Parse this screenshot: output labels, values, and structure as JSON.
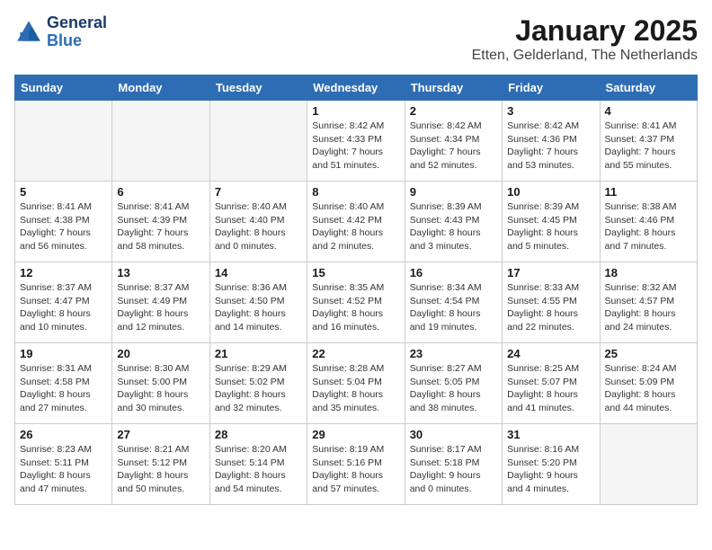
{
  "logo": {
    "line1": "General",
    "line2": "Blue"
  },
  "title": "January 2025",
  "subtitle": "Etten, Gelderland, The Netherlands",
  "headers": [
    "Sunday",
    "Monday",
    "Tuesday",
    "Wednesday",
    "Thursday",
    "Friday",
    "Saturday"
  ],
  "weeks": [
    [
      {
        "date": "",
        "info": ""
      },
      {
        "date": "",
        "info": ""
      },
      {
        "date": "",
        "info": ""
      },
      {
        "date": "1",
        "info": "Sunrise: 8:42 AM\nSunset: 4:33 PM\nDaylight: 7 hours\nand 51 minutes."
      },
      {
        "date": "2",
        "info": "Sunrise: 8:42 AM\nSunset: 4:34 PM\nDaylight: 7 hours\nand 52 minutes."
      },
      {
        "date": "3",
        "info": "Sunrise: 8:42 AM\nSunset: 4:36 PM\nDaylight: 7 hours\nand 53 minutes."
      },
      {
        "date": "4",
        "info": "Sunrise: 8:41 AM\nSunset: 4:37 PM\nDaylight: 7 hours\nand 55 minutes."
      }
    ],
    [
      {
        "date": "5",
        "info": "Sunrise: 8:41 AM\nSunset: 4:38 PM\nDaylight: 7 hours\nand 56 minutes."
      },
      {
        "date": "6",
        "info": "Sunrise: 8:41 AM\nSunset: 4:39 PM\nDaylight: 7 hours\nand 58 minutes."
      },
      {
        "date": "7",
        "info": "Sunrise: 8:40 AM\nSunset: 4:40 PM\nDaylight: 8 hours\nand 0 minutes."
      },
      {
        "date": "8",
        "info": "Sunrise: 8:40 AM\nSunset: 4:42 PM\nDaylight: 8 hours\nand 2 minutes."
      },
      {
        "date": "9",
        "info": "Sunrise: 8:39 AM\nSunset: 4:43 PM\nDaylight: 8 hours\nand 3 minutes."
      },
      {
        "date": "10",
        "info": "Sunrise: 8:39 AM\nSunset: 4:45 PM\nDaylight: 8 hours\nand 5 minutes."
      },
      {
        "date": "11",
        "info": "Sunrise: 8:38 AM\nSunset: 4:46 PM\nDaylight: 8 hours\nand 7 minutes."
      }
    ],
    [
      {
        "date": "12",
        "info": "Sunrise: 8:37 AM\nSunset: 4:47 PM\nDaylight: 8 hours\nand 10 minutes."
      },
      {
        "date": "13",
        "info": "Sunrise: 8:37 AM\nSunset: 4:49 PM\nDaylight: 8 hours\nand 12 minutes."
      },
      {
        "date": "14",
        "info": "Sunrise: 8:36 AM\nSunset: 4:50 PM\nDaylight: 8 hours\nand 14 minutes."
      },
      {
        "date": "15",
        "info": "Sunrise: 8:35 AM\nSunset: 4:52 PM\nDaylight: 8 hours\nand 16 minutes."
      },
      {
        "date": "16",
        "info": "Sunrise: 8:34 AM\nSunset: 4:54 PM\nDaylight: 8 hours\nand 19 minutes."
      },
      {
        "date": "17",
        "info": "Sunrise: 8:33 AM\nSunset: 4:55 PM\nDaylight: 8 hours\nand 22 minutes."
      },
      {
        "date": "18",
        "info": "Sunrise: 8:32 AM\nSunset: 4:57 PM\nDaylight: 8 hours\nand 24 minutes."
      }
    ],
    [
      {
        "date": "19",
        "info": "Sunrise: 8:31 AM\nSunset: 4:58 PM\nDaylight: 8 hours\nand 27 minutes."
      },
      {
        "date": "20",
        "info": "Sunrise: 8:30 AM\nSunset: 5:00 PM\nDaylight: 8 hours\nand 30 minutes."
      },
      {
        "date": "21",
        "info": "Sunrise: 8:29 AM\nSunset: 5:02 PM\nDaylight: 8 hours\nand 32 minutes."
      },
      {
        "date": "22",
        "info": "Sunrise: 8:28 AM\nSunset: 5:04 PM\nDaylight: 8 hours\nand 35 minutes."
      },
      {
        "date": "23",
        "info": "Sunrise: 8:27 AM\nSunset: 5:05 PM\nDaylight: 8 hours\nand 38 minutes."
      },
      {
        "date": "24",
        "info": "Sunrise: 8:25 AM\nSunset: 5:07 PM\nDaylight: 8 hours\nand 41 minutes."
      },
      {
        "date": "25",
        "info": "Sunrise: 8:24 AM\nSunset: 5:09 PM\nDaylight: 8 hours\nand 44 minutes."
      }
    ],
    [
      {
        "date": "26",
        "info": "Sunrise: 8:23 AM\nSunset: 5:11 PM\nDaylight: 8 hours\nand 47 minutes."
      },
      {
        "date": "27",
        "info": "Sunrise: 8:21 AM\nSunset: 5:12 PM\nDaylight: 8 hours\nand 50 minutes."
      },
      {
        "date": "28",
        "info": "Sunrise: 8:20 AM\nSunset: 5:14 PM\nDaylight: 8 hours\nand 54 minutes."
      },
      {
        "date": "29",
        "info": "Sunrise: 8:19 AM\nSunset: 5:16 PM\nDaylight: 8 hours\nand 57 minutes."
      },
      {
        "date": "30",
        "info": "Sunrise: 8:17 AM\nSunset: 5:18 PM\nDaylight: 9 hours\nand 0 minutes."
      },
      {
        "date": "31",
        "info": "Sunrise: 8:16 AM\nSunset: 5:20 PM\nDaylight: 9 hours\nand 4 minutes."
      },
      {
        "date": "",
        "info": ""
      }
    ]
  ]
}
